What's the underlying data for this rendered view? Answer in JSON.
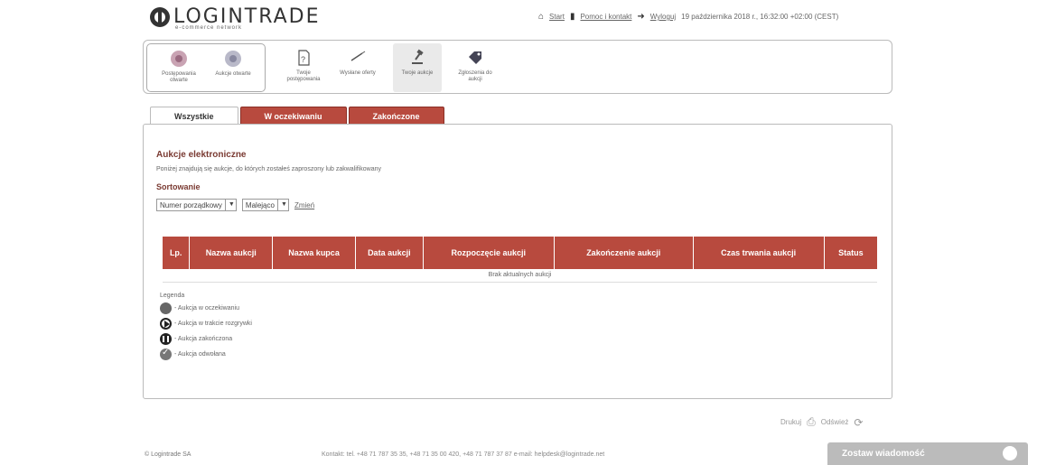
{
  "header": {
    "logo_text": "LOGINTRADE",
    "logo_sub": "e-commerce network",
    "nav": {
      "start_label": "Start",
      "help_label": "Pomoc i kontakt",
      "logout_label": "Wyloguj",
      "datetime": "19 października 2018 r., 16:32:00 +02:00 (CEST)"
    }
  },
  "toolbar": {
    "buttons": [
      {
        "label": "Postępowania otwarte",
        "icon": "megaphone-icon"
      },
      {
        "label": "Aukcje otwarte",
        "icon": "gavel-globe-icon"
      },
      {
        "label": "Twoje postępowania",
        "icon": "document-icon"
      },
      {
        "label": "Wysłane oferty",
        "icon": "pen-icon"
      },
      {
        "label": "Twoje aukcje",
        "icon": "gavel-icon"
      },
      {
        "label": "Zgłoszenia do aukcji",
        "icon": "tag-icon"
      }
    ]
  },
  "tabs": [
    {
      "label": "Wszystkie",
      "active": true
    },
    {
      "label": "W oczekiwaniu",
      "active": false
    },
    {
      "label": "Zakończone",
      "active": false
    }
  ],
  "main": {
    "section_title": "Aukcje elektroniczne",
    "section_desc": "Poniżej znajdują się aukcje, do których zostałeś zaproszony lub zakwalifikowany",
    "sort_title": "Sortowanie",
    "sort_field": "Numer porządkowy",
    "sort_order": "Malejąco",
    "change_label": "Zmień"
  },
  "table": {
    "columns": [
      "Lp.",
      "Nazwa aukcji",
      "Nazwa kupca",
      "Data aukcji",
      "Rozpoczęcie aukcji",
      "Zakończenie aukcji",
      "Czas trwania aukcji",
      "Status"
    ],
    "empty_message": "Brak aktualnych aukcji"
  },
  "legend": {
    "title": "Legenda",
    "items": [
      {
        "label": "- Aukcja w oczekiwaniu",
        "icon": "clock-icon"
      },
      {
        "label": "- Aukcja w trakcie rozgrywki",
        "icon": "play-icon"
      },
      {
        "label": "- Aukcja zakończona",
        "icon": "pause-icon"
      },
      {
        "label": "- Aukcja odwołana",
        "icon": "check-icon"
      }
    ]
  },
  "aux": {
    "print_label": "Drukuj",
    "refresh_label": "Odśwież"
  },
  "footer": {
    "copyright": "© Logintrade SA",
    "contact": "Kontakt: tel. +48 71 787 35 35, +48 71 35 00 420, +48 71 787 37 87 e-mail: helpdesk@logintrade.net",
    "cta_label": "Zostaw wiadomość"
  },
  "colors": {
    "accent": "#b84a3e",
    "accent_dark": "#8a2f26",
    "title": "#7a3a32"
  }
}
